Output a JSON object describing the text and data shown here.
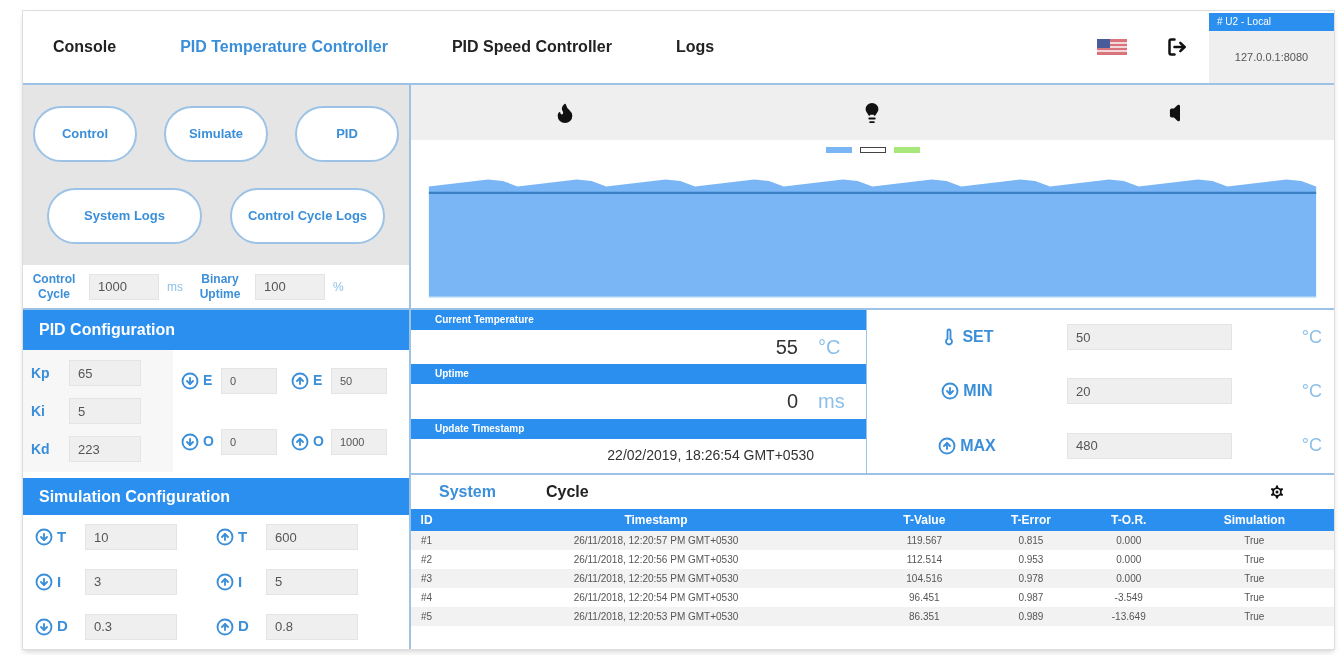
{
  "nav": {
    "tabs": [
      {
        "label": "Console",
        "selected": false
      },
      {
        "label": "PID Temperature Controller",
        "selected": true
      },
      {
        "label": "PID Speed Controller",
        "selected": false
      },
      {
        "label": "Logs",
        "selected": false
      }
    ],
    "server": {
      "name": "# U2 - Local",
      "address": "127.0.0.1:8080"
    }
  },
  "action_rows": [
    [
      {
        "label": "Control"
      },
      {
        "label": "Simulate"
      },
      {
        "label": "PID"
      }
    ],
    [
      {
        "label": "System Logs"
      },
      {
        "label": "Control Cycle Logs"
      }
    ]
  ],
  "cycle_fields": [
    {
      "label": "Control Cycle",
      "value": "1000",
      "unit": "ms"
    },
    {
      "label": "Binary Uptime",
      "value": "100",
      "unit": "%"
    }
  ],
  "pid": {
    "title": "PID Configuration",
    "gains": [
      {
        "label": "Kp",
        "value": "65"
      },
      {
        "label": "Ki",
        "value": "5"
      },
      {
        "label": "Kd",
        "value": "223"
      }
    ],
    "limits": [
      {
        "kind": "down",
        "label": "E",
        "value": "0"
      },
      {
        "kind": "up",
        "label": "E",
        "value": "50"
      },
      {
        "kind": "down",
        "label": "O",
        "value": "0"
      },
      {
        "kind": "up",
        "label": "O",
        "value": "1000"
      }
    ]
  },
  "simulation": {
    "title": "Simulation Configuration",
    "params": [
      {
        "kind": "down",
        "label": "T",
        "value": "10"
      },
      {
        "kind": "up",
        "label": "T",
        "value": "600"
      },
      {
        "kind": "down",
        "label": "I",
        "value": "3"
      },
      {
        "kind": "up",
        "label": "I",
        "value": "5"
      },
      {
        "kind": "down",
        "label": "D",
        "value": "0.3"
      },
      {
        "kind": "up",
        "label": "D",
        "value": "0.8"
      }
    ]
  },
  "readouts": [
    {
      "title": "Current Temperature",
      "value": "55",
      "unit": "°C"
    },
    {
      "title": "Uptime",
      "value": "0",
      "unit": "ms"
    },
    {
      "title": "Update Timestamp",
      "value": "22/02/2019, 18:26:54 GMT+0530"
    }
  ],
  "setpoints": [
    {
      "kind": "set",
      "label": "SET",
      "value": "50",
      "unit": "°C"
    },
    {
      "kind": "down",
      "label": "MIN",
      "value": "20",
      "unit": "°C"
    },
    {
      "kind": "up",
      "label": "MAX",
      "value": "480",
      "unit": "°C"
    }
  ],
  "logs": {
    "tabs": [
      {
        "label": "System",
        "selected": false
      },
      {
        "label": "Cycle",
        "selected": true
      }
    ],
    "columns": [
      "ID",
      "Timestamp",
      "T-Value",
      "T-Error",
      "T-O.R.",
      "Simulation"
    ],
    "rows": [
      [
        "#1",
        "26/11/2018, 12:20:57 PM GMT+0530",
        "119.567",
        "0.815",
        "0.000",
        "True"
      ],
      [
        "#2",
        "26/11/2018, 12:20:56 PM GMT+0530",
        "112.514",
        "0.953",
        "0.000",
        "True"
      ],
      [
        "#3",
        "26/11/2018, 12:20:55 PM GMT+0530",
        "104.516",
        "0.978",
        "0.000",
        "True"
      ],
      [
        "#4",
        "26/11/2018, 12:20:54 PM GMT+0530",
        "96.451",
        "0.987",
        "-3.549",
        "True"
      ],
      [
        "#5",
        "26/11/2018, 12:20:53 PM GMT+0530",
        "86.351",
        "0.989",
        "-13.649",
        "True"
      ]
    ]
  }
}
